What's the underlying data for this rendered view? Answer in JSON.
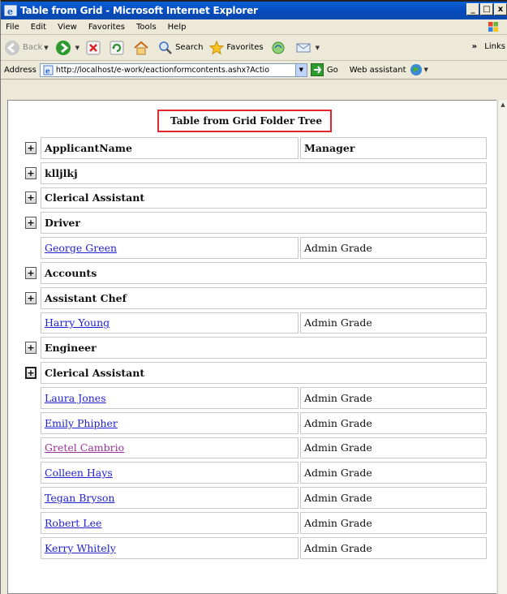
{
  "window": {
    "title": "Table from Grid - Microsoft Internet Explorer",
    "buttons": [
      "_",
      "□",
      "x"
    ]
  },
  "menu": {
    "items": [
      {
        "label": "File"
      },
      {
        "label": "Edit"
      },
      {
        "label": "View"
      },
      {
        "label": "Favorites"
      },
      {
        "label": "Tools"
      },
      {
        "label": "Help"
      }
    ]
  },
  "toolbar": {
    "back": "Back",
    "search": "Search",
    "favorites": "Favorites",
    "chevron": "»",
    "links": "Links"
  },
  "address": {
    "label": "Address",
    "url": "http://localhost/e-work/eactionformcontents.ashx?Actio",
    "go": "Go",
    "web_assistant": "Web assistant"
  },
  "page": {
    "title": "Table from Grid Folder Tree",
    "header": {
      "name": "ApplicantName",
      "manager": "Manager"
    },
    "rows": [
      {
        "type": "group",
        "text": "klljlkj",
        "expander": "+"
      },
      {
        "type": "group",
        "text": "Clerical Assistant",
        "expander": "+"
      },
      {
        "type": "group",
        "text": "Driver",
        "expander": "+"
      },
      {
        "type": "item",
        "name": "George Green",
        "manager": "Admin Grade"
      },
      {
        "type": "group",
        "text": "Accounts",
        "expander": "+"
      },
      {
        "type": "group",
        "text": "Assistant Chef",
        "expander": "+"
      },
      {
        "type": "item",
        "name": "Harry Young",
        "manager": "Admin Grade"
      },
      {
        "type": "group",
        "text": "Engineer",
        "expander": "+"
      },
      {
        "type": "group",
        "text": "Clerical Assistant",
        "expander": "+",
        "active": true
      },
      {
        "type": "item",
        "name": "Laura Jones",
        "manager": "Admin Grade"
      },
      {
        "type": "item",
        "name": "Emily Phipher",
        "manager": "Admin Grade"
      },
      {
        "type": "item",
        "name": "Gretel Cambrio",
        "manager": "Admin Grade",
        "visited": true
      },
      {
        "type": "item",
        "name": "Colleen Hays",
        "manager": "Admin Grade"
      },
      {
        "type": "item",
        "name": "Tegan Bryson",
        "manager": "Admin Grade"
      },
      {
        "type": "item",
        "name": "Robert Lee",
        "manager": "Admin Grade"
      },
      {
        "type": "item",
        "name": "Kerry Whitely",
        "manager": "Admin Grade"
      }
    ]
  },
  "colors": {
    "title_highlight": "#e2262c",
    "link": "#2222cc",
    "visited_link": "#993399",
    "titlebar": "#0649b8"
  }
}
